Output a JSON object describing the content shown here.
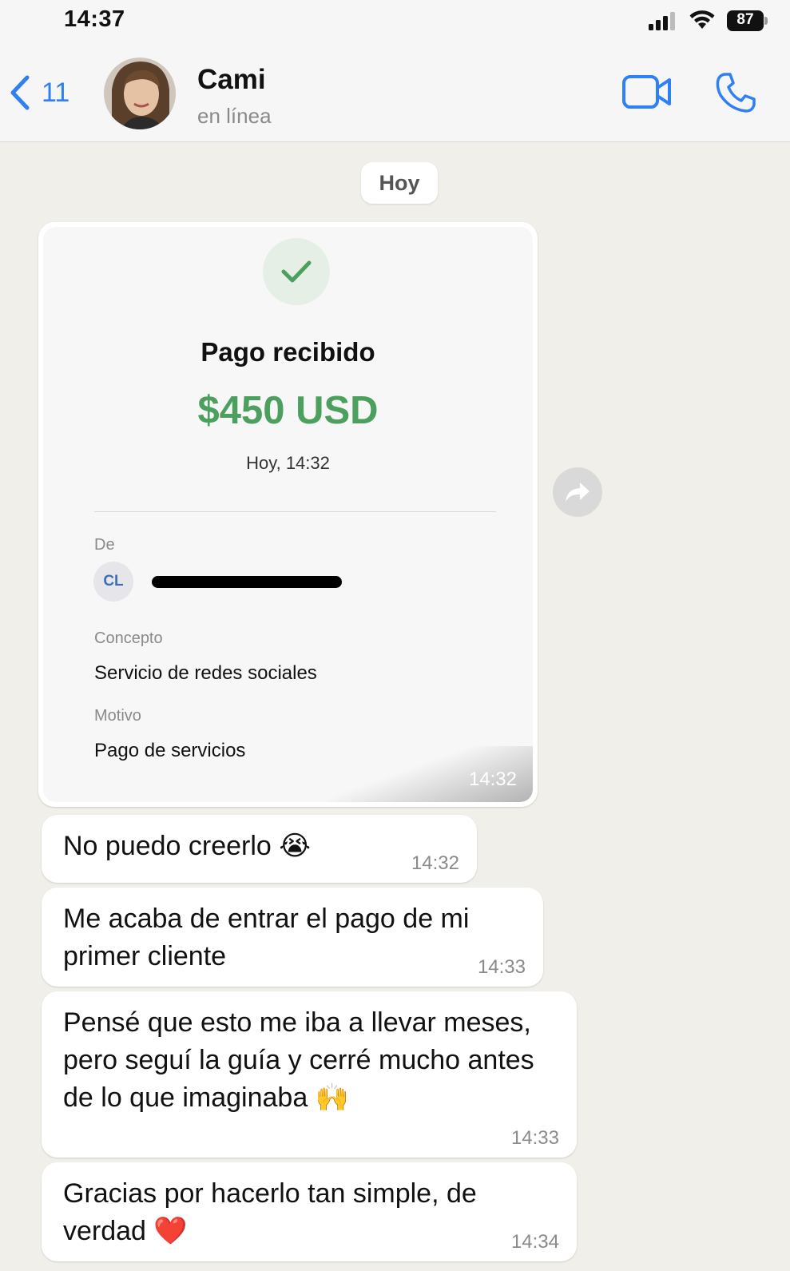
{
  "status_bar": {
    "time": "14:37",
    "battery": "87"
  },
  "header": {
    "back_count": "11",
    "contact_name": "Cami",
    "contact_status": "en línea"
  },
  "day_label": "Hoy",
  "receipt": {
    "title": "Pago recibido",
    "amount": "$450 USD",
    "date": "Hoy, 14:32",
    "from_label": "De",
    "initials": "CL",
    "concept_label": "Concepto",
    "concept": "Servicio de redes sociales",
    "motivo_label": "Motivo",
    "motivo": "Pago de servicios",
    "time": "14:32"
  },
  "messages": [
    {
      "text": "No puedo creerlo",
      "emoji": "😭",
      "time": "14:32"
    },
    {
      "text": "Me acaba de entrar el pago de mi primer cliente",
      "time": "14:33"
    },
    {
      "text": "Pensé que esto me iba a llevar meses, pero seguí la guía y cerré mucho antes de lo que imaginaba",
      "emoji": "🙌",
      "time": "14:33"
    },
    {
      "text": "Gracias por hacerlo tan simple, de verdad",
      "emoji": "❤️",
      "time": "14:34"
    }
  ],
  "colors": {
    "accent": "#2f7ff5",
    "amount_green": "#4aa05c",
    "chat_bg": "#f1efe9"
  }
}
